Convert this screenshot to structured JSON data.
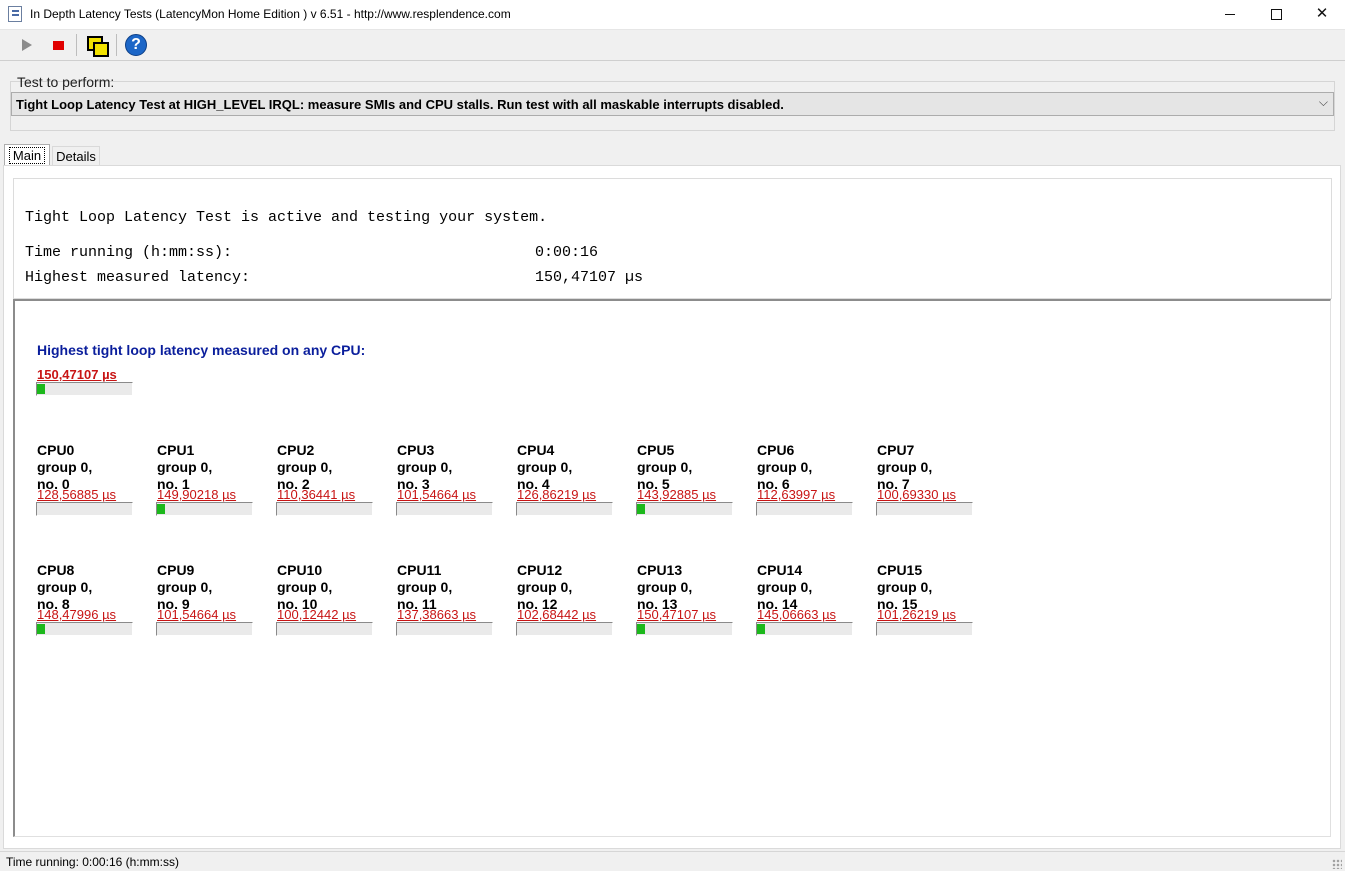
{
  "window": {
    "title": "In Depth Latency Tests  (LatencyMon Home Edition )  v 6.51 - http://www.resplendence.com",
    "min_label": "",
    "close_label": "✕"
  },
  "toolbar": {
    "icons": [
      "play-icon",
      "stop-icon",
      "windows-icon",
      "help-icon"
    ],
    "help_glyph": "?"
  },
  "test": {
    "label": "Test to perform:",
    "selected": "Tight Loop Latency Test at HIGH_LEVEL IRQL:  measure SMIs and CPU stalls. Run test with all maskable interrupts disabled.",
    "arrow": "⌵"
  },
  "tabs": [
    {
      "label": "Main",
      "active": true
    },
    {
      "label": "Details",
      "active": false
    }
  ],
  "info": {
    "status": "Tight Loop Latency Test is active and testing your system.",
    "time_label": "Time running (h:mm:ss):",
    "time_value": "0:00:16",
    "highest_label": "Highest measured latency:",
    "highest_value": "150,47107 µs"
  },
  "overall": {
    "heading": "Highest tight loop latency measured on any CPU:",
    "value": "150,47107 µs",
    "fill": 0.08
  },
  "cpus": [
    {
      "name": "CPU0",
      "group": "group 0,",
      "no": "no. 0",
      "value": "128,56885 µs",
      "fill": 0.0
    },
    {
      "name": "CPU1",
      "group": "group 0,",
      "no": "no. 1",
      "value": "149,90218 µs",
      "fill": 0.08
    },
    {
      "name": "CPU2",
      "group": "group 0,",
      "no": "no. 2",
      "value": "110,36441 µs",
      "fill": 0.0
    },
    {
      "name": "CPU3",
      "group": "group 0,",
      "no": "no. 3",
      "value": "101,54664 µs",
      "fill": 0.0
    },
    {
      "name": "CPU4",
      "group": "group 0,",
      "no": "no. 4",
      "value": "126,86219 µs",
      "fill": 0.0
    },
    {
      "name": "CPU5",
      "group": "group 0,",
      "no": "no. 5",
      "value": "143,92885 µs",
      "fill": 0.08
    },
    {
      "name": "CPU6",
      "group": "group 0,",
      "no": "no. 6",
      "value": "112,63997 µs",
      "fill": 0.0
    },
    {
      "name": "CPU7",
      "group": "group 0,",
      "no": "no. 7",
      "value": "100,69330 µs",
      "fill": 0.0
    },
    {
      "name": "CPU8",
      "group": "group 0,",
      "no": "no. 8",
      "value": "148,47996 µs",
      "fill": 0.08
    },
    {
      "name": "CPU9",
      "group": "group 0,",
      "no": "no. 9",
      "value": "101,54664 µs",
      "fill": 0.0
    },
    {
      "name": "CPU10",
      "group": "group 0,",
      "no": "no. 10",
      "value": "100,12442 µs",
      "fill": 0.0
    },
    {
      "name": "CPU11",
      "group": "group 0,",
      "no": "no. 11",
      "value": "137,38663 µs",
      "fill": 0.0
    },
    {
      "name": "CPU12",
      "group": "group 0,",
      "no": "no. 12",
      "value": "102,68442 µs",
      "fill": 0.0
    },
    {
      "name": "CPU13",
      "group": "group 0,",
      "no": "no. 13",
      "value": "150,47107 µs",
      "fill": 0.08
    },
    {
      "name": "CPU14",
      "group": "group 0,",
      "no": "no. 14",
      "value": "145,06663 µs",
      "fill": 0.08
    },
    {
      "name": "CPU15",
      "group": "group 0,",
      "no": "no. 15",
      "value": "101,26219 µs",
      "fill": 0.0
    }
  ],
  "statusbar": {
    "text": "Time running: 0:00:16  (h:mm:ss)"
  },
  "colors": {
    "heading_blue": "#0a1e9c",
    "value_red": "#c81414",
    "bar_green": "#1cb81c"
  }
}
